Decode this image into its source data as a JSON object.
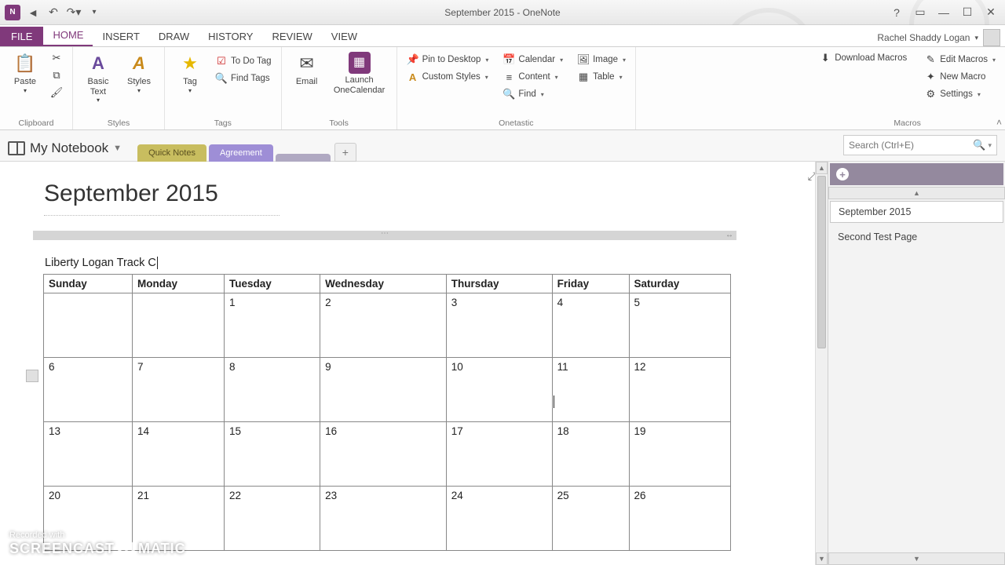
{
  "window": {
    "title": "September 2015 - OneNote"
  },
  "user": {
    "name": "Rachel Shaddy Logan"
  },
  "tabs": {
    "file": "FILE",
    "items": [
      "HOME",
      "INSERT",
      "DRAW",
      "HISTORY",
      "REVIEW",
      "VIEW"
    ],
    "active": "HOME"
  },
  "ribbon": {
    "groups": {
      "clipboard": {
        "label": "Clipboard",
        "paste": "Paste"
      },
      "basictext": {
        "label": "Basic\nText"
      },
      "styles": {
        "label": "Styles",
        "btn": "Styles"
      },
      "tags": {
        "label": "Tags",
        "tag": "Tag",
        "todo": "To Do Tag",
        "find": "Find Tags"
      },
      "tools": {
        "label": "Tools",
        "email": "Email",
        "onecal": "Launch\nOneCalendar"
      },
      "onetastic": {
        "label": "Onetastic",
        "pin": "Pin to Desktop",
        "custom": "Custom Styles",
        "calendar": "Calendar",
        "content": "Content",
        "find": "Find",
        "image": "Image",
        "table": "Table"
      },
      "macros": {
        "label": "Macros",
        "download": "Download Macros",
        "edit": "Edit Macros",
        "new": "New Macro",
        "settings": "Settings"
      }
    }
  },
  "notebook": {
    "name": "My Notebook",
    "sections": [
      "Quick Notes",
      "Agreement",
      ""
    ],
    "add": "+"
  },
  "search": {
    "placeholder": "Search (Ctrl+E)"
  },
  "page": {
    "title": "September 2015",
    "note_title": "Liberty Logan Track C",
    "days": [
      "Sunday",
      "Monday",
      "Tuesday",
      "Wednesday",
      "Thursday",
      "Friday",
      "Saturday"
    ],
    "rows": [
      [
        "",
        "",
        "1",
        "2",
        "3",
        "4",
        "5"
      ],
      [
        "6",
        "7",
        "8",
        "9",
        "10",
        "11",
        "12"
      ],
      [
        "13",
        "14",
        "15",
        "16",
        "17",
        "18",
        "19"
      ],
      [
        "20",
        "21",
        "22",
        "23",
        "24",
        "25",
        "26"
      ]
    ]
  },
  "pagepane": {
    "items": [
      "September 2015",
      "Second Test Page"
    ],
    "active": 0
  },
  "watermark": {
    "l1": "Recorded with",
    "l2a": "SCREENCAST",
    "l2b": "MATIC"
  }
}
